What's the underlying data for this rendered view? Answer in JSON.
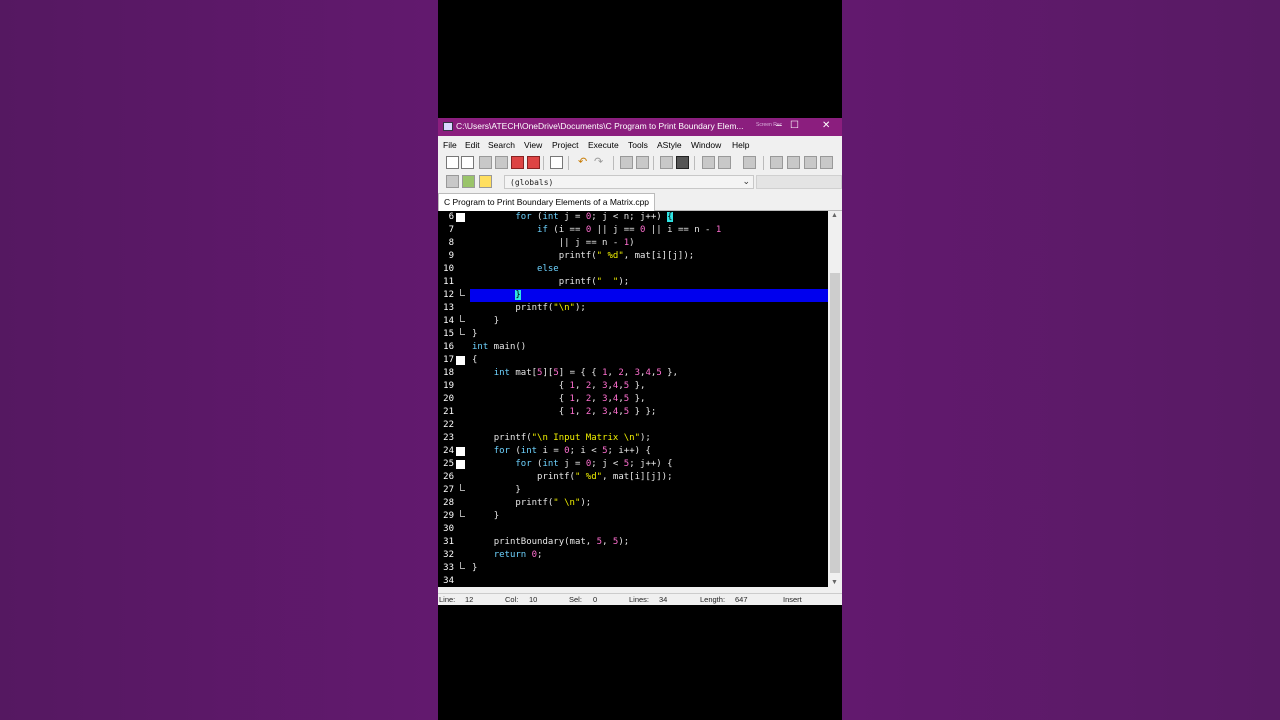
{
  "window": {
    "title": "C:\\Users\\ATECH\\OneDrive\\Documents\\C Program to Print Boundary Elem...",
    "ghost_text": "Screen Rec",
    "minimize": "–",
    "maximize": "☐",
    "close": "✕"
  },
  "menu": [
    "File",
    "Edit",
    "Search",
    "View",
    "Project",
    "Execute",
    "Tools",
    "AStyle",
    "Window",
    "Help"
  ],
  "toolbar": {
    "scope_value": "(globals)"
  },
  "tab": {
    "label": "C Program to Print Boundary Elements of a Matrix.cpp"
  },
  "editor": {
    "lines": [
      {
        "num": "6"
      },
      {
        "num": "7"
      },
      {
        "num": "8"
      },
      {
        "num": "9"
      },
      {
        "num": "10"
      },
      {
        "num": "11"
      },
      {
        "num": "12"
      },
      {
        "num": "13"
      },
      {
        "num": "14"
      },
      {
        "num": "15"
      },
      {
        "num": "16"
      },
      {
        "num": "17"
      },
      {
        "num": "18"
      },
      {
        "num": "19"
      },
      {
        "num": "20"
      },
      {
        "num": "21"
      },
      {
        "num": "22"
      },
      {
        "num": "23"
      },
      {
        "num": "24"
      },
      {
        "num": "25"
      },
      {
        "num": "26"
      },
      {
        "num": "27"
      },
      {
        "num": "28"
      },
      {
        "num": "29"
      },
      {
        "num": "30"
      },
      {
        "num": "31"
      },
      {
        "num": "32"
      },
      {
        "num": "33"
      },
      {
        "num": "34"
      }
    ],
    "code": {
      "l6": {
        "kw1": "for",
        "p1": " (",
        "kw2": "int",
        "p2": " j = ",
        "n1": "0",
        "p3": "; j < n; j++) ",
        "br": "{"
      },
      "l7": {
        "kw1": "if",
        "p1": " (i == ",
        "n1": "0",
        "p2": " || j == ",
        "n2": "0",
        "p3": " || i == n - ",
        "n3": "1"
      },
      "l8": {
        "p1": "|| j == n - ",
        "n1": "1",
        "p2": ")"
      },
      "l9": {
        "p1": "printf(",
        "s1": "\" %d\"",
        "p2": ", mat[i][j]);"
      },
      "l10": {
        "kw1": "else"
      },
      "l11": {
        "p1": "printf(",
        "s1": "\"  \"",
        "p2": ");"
      },
      "l12": {
        "br": "}"
      },
      "l13": {
        "p1": "printf(",
        "s1": "\"\\n\"",
        "p2": ");"
      },
      "l14": {
        "p1": "}"
      },
      "l15": {
        "p1": "}"
      },
      "l16": {
        "kw1": "int",
        "p1": " main()"
      },
      "l17": {
        "p1": "{"
      },
      "l18": {
        "kw1": "int",
        "p1": " mat[",
        "n1": "5",
        "p2": "][",
        "n2": "5",
        "p3": "] = { { ",
        "n3": "1",
        "p4": ", ",
        "n4": "2",
        "p5": ", ",
        "n5": "3",
        "p6": ",",
        "n6": "4",
        "p7": ",",
        "n7": "5",
        "p8": " },"
      },
      "l19": {
        "p1": "{ ",
        "n1": "1",
        "p2": ", ",
        "n2": "2",
        "p3": ", ",
        "n3": "3",
        "p4": ",",
        "n4": "4",
        "p5": ",",
        "n5": "5",
        "p6": " },"
      },
      "l20": {
        "p1": "{ ",
        "n1": "1",
        "p2": ", ",
        "n2": "2",
        "p3": ", ",
        "n3": "3",
        "p4": ",",
        "n4": "4",
        "p5": ",",
        "n5": "5",
        "p6": " },"
      },
      "l21": {
        "p1": "{ ",
        "n1": "1",
        "p2": ", ",
        "n2": "2",
        "p3": ", ",
        "n3": "3",
        "p4": ",",
        "n4": "4",
        "p5": ",",
        "n5": "5",
        "p6": " } };"
      },
      "l23": {
        "p1": "printf(",
        "s1": "\"\\n Input Matrix \\n\"",
        "p2": ");"
      },
      "l24": {
        "kw1": "for",
        "p1": " (",
        "kw2": "int",
        "p2": " i = ",
        "n1": "0",
        "p3": "; i < ",
        "n2": "5",
        "p4": "; i++) {"
      },
      "l25": {
        "kw1": "for",
        "p1": " (",
        "kw2": "int",
        "p2": " j = ",
        "n1": "0",
        "p3": "; j < ",
        "n2": "5",
        "p4": "; j++) {"
      },
      "l26": {
        "p1": "printf(",
        "s1": "\" %d\"",
        "p2": ", mat[i][j]);"
      },
      "l27": {
        "p1": "}"
      },
      "l28": {
        "p1": "printf(",
        "s1": "\" \\n\"",
        "p2": ");"
      },
      "l29": {
        "p1": "}"
      },
      "l31": {
        "p1": "printBoundary(mat, ",
        "n1": "5",
        "p2": ", ",
        "n2": "5",
        "p3": ");"
      },
      "l32": {
        "kw1": "return",
        "p1": " ",
        "n1": "0",
        "p2": ";"
      },
      "l33": {
        "p1": "}"
      }
    }
  },
  "status": {
    "line_label": "Line:",
    "line_value": "12",
    "col_label": "Col:",
    "col_value": "10",
    "sel_label": "Sel:",
    "sel_value": "0",
    "lines_label": "Lines:",
    "lines_value": "34",
    "length_label": "Length:",
    "length_value": "647",
    "mode": "Insert"
  },
  "colors": {
    "titlebar": "#8b1e7e",
    "current_line": "#0000ee",
    "keyword": "#6ed3ff",
    "number": "#ff6fd0",
    "string": "#f0f000",
    "background": "#5c1a69"
  }
}
